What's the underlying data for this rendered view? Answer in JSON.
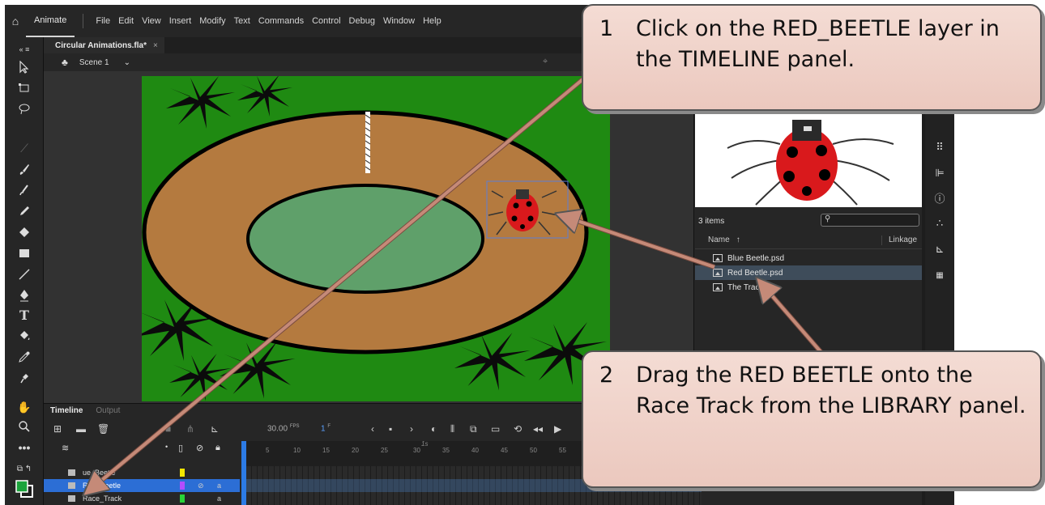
{
  "menubar": {
    "app_name": "Animate",
    "items": [
      "File",
      "Edit",
      "View",
      "Insert",
      "Modify",
      "Text",
      "Commands",
      "Control",
      "Debug",
      "Window",
      "Help"
    ]
  },
  "document": {
    "tab_title": "Circular Animations.fla*",
    "scene": "Scene 1"
  },
  "library": {
    "item_count": "3 items",
    "col_name": "Name",
    "col_linkage": "Linkage",
    "items": [
      {
        "name": "Blue Beetle.psd",
        "selected": false
      },
      {
        "name": "Red Beetle.psd",
        "selected": true
      },
      {
        "name": "The Track",
        "selected": false
      }
    ]
  },
  "timeline": {
    "tabs": [
      "Timeline",
      "Output"
    ],
    "fps_value": "30.00",
    "fps_unit": "FPS",
    "frame_value": "1",
    "frame_unit": "F",
    "marker_label": "1s",
    "tick_labels": [
      "5",
      "10",
      "15",
      "20",
      "25",
      "30",
      "35",
      "40",
      "45",
      "50",
      "55"
    ],
    "layers": [
      {
        "name": "Blue_Beetle",
        "shown": "ue_Beetle",
        "color": "#f2e600",
        "selected": false
      },
      {
        "name": "Red_Beetle",
        "shown": "Red_Beetle",
        "color": "#b24dff",
        "selected": true
      },
      {
        "name": "Race_Track",
        "shown": "Race_Track",
        "color": "#29d437",
        "selected": false
      }
    ]
  },
  "callouts": {
    "step1_num": "1",
    "step1_text": "Click on the RED_BEETLE layer in the TIMELINE panel.",
    "step2_num": "2",
    "step2_text": "Drag the RED BEETLE onto the Race Track from the LIBRARY panel."
  },
  "colors": {
    "stage_grass": "#1f8a12",
    "track": "#b47a3f",
    "infield": "#5fa06a",
    "selection_blue": "#2c6ed5",
    "callout_fill": "#efd2c8",
    "arrow": "#c58a78"
  }
}
